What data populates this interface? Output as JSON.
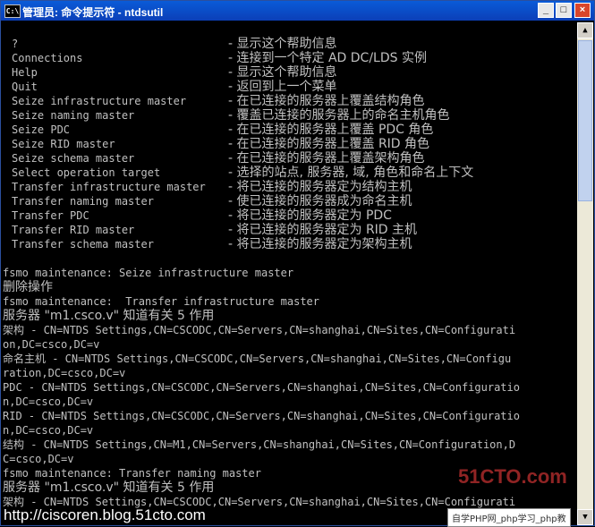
{
  "window": {
    "icon_text": "C:\\",
    "title": "管理员: 命令提示符 - ntdsutil",
    "minimize": "_",
    "maximize": "□",
    "close": "×"
  },
  "help": [
    {
      "cmd": "?",
      "desc": "- 显示这个帮助信息"
    },
    {
      "cmd": "Connections",
      "desc": "- 连接到一个特定 AD DC/LDS 实例"
    },
    {
      "cmd": "Help",
      "desc": "- 显示这个帮助信息"
    },
    {
      "cmd": "Quit",
      "desc": "- 返回到上一个菜单"
    },
    {
      "cmd": "Seize infrastructure master",
      "desc": "- 在已连接的服务器上覆盖结构角色"
    },
    {
      "cmd": "Seize naming master",
      "desc": "- 覆盖已连接的服务器上的命名主机角色"
    },
    {
      "cmd": "Seize PDC",
      "desc": "- 在已连接的服务器上覆盖 PDC 角色"
    },
    {
      "cmd": "Seize RID master",
      "desc": "- 在已连接的服务器上覆盖 RID 角色"
    },
    {
      "cmd": "Seize schema master",
      "desc": "- 在已连接的服务器上覆盖架构角色"
    },
    {
      "cmd": "Select operation target",
      "desc": "- 选择的站点, 服务器, 域, 角色和命名上下文"
    },
    {
      "cmd": "Transfer infrastructure master",
      "desc": "- 将已连接的服务器定为结构主机"
    },
    {
      "cmd": "Transfer naming master",
      "desc": "- 使已连接的服务器成为命名主机"
    },
    {
      "cmd": "Transfer PDC",
      "desc": "- 将已连接的服务器定为 PDC"
    },
    {
      "cmd": "Transfer RID master",
      "desc": "- 将已连接的服务器定为 RID 主机"
    },
    {
      "cmd": "Transfer schema master",
      "desc": "- 将已连接的服务器定为架构主机"
    }
  ],
  "output": [
    {
      "text": "",
      "cjk": false
    },
    {
      "text": "fsmo maintenance: Seize infrastructure master",
      "cjk": false
    },
    {
      "text": "删除操作",
      "cjk": true
    },
    {
      "text": "fsmo maintenance:  Transfer infrastructure master",
      "cjk": false
    },
    {
      "text": "服务器 \"m1.csco.v\" 知道有关 5 作用",
      "cjk": true
    },
    {
      "text": "架构 - CN=NTDS Settings,CN=CSCODC,CN=Servers,CN=shanghai,CN=Sites,CN=Configurati",
      "cjk": false
    },
    {
      "text": "on,DC=csco,DC=v",
      "cjk": false
    },
    {
      "text": "命名主机 - CN=NTDS Settings,CN=CSCODC,CN=Servers,CN=shanghai,CN=Sites,CN=Configu",
      "cjk": false
    },
    {
      "text": "ration,DC=csco,DC=v",
      "cjk": false
    },
    {
      "text": "PDC - CN=NTDS Settings,CN=CSCODC,CN=Servers,CN=shanghai,CN=Sites,CN=Configuratio",
      "cjk": false
    },
    {
      "text": "n,DC=csco,DC=v",
      "cjk": false
    },
    {
      "text": "RID - CN=NTDS Settings,CN=CSCODC,CN=Servers,CN=shanghai,CN=Sites,CN=Configuratio",
      "cjk": false
    },
    {
      "text": "n,DC=csco,DC=v",
      "cjk": false
    },
    {
      "text": "结构 - CN=NTDS Settings,CN=M1,CN=Servers,CN=shanghai,CN=Sites,CN=Configuration,D",
      "cjk": false
    },
    {
      "text": "C=csco,DC=v",
      "cjk": false
    },
    {
      "text": "fsmo maintenance: Transfer naming master",
      "cjk": false
    },
    {
      "text": "服务器 \"m1.csco.v\" 知道有关 5 作用",
      "cjk": true
    },
    {
      "text": "架构 - CN=NTDS Settings,CN=CSCODC,CN=Servers,CN=shanghai,CN=Sites,CN=Configurati",
      "cjk": false
    }
  ],
  "watermark": {
    "url": "http://ciscoren.blog.51cto.com",
    "logo": "51CTO.com",
    "bar": "自学PHP网_php学习_php教"
  }
}
